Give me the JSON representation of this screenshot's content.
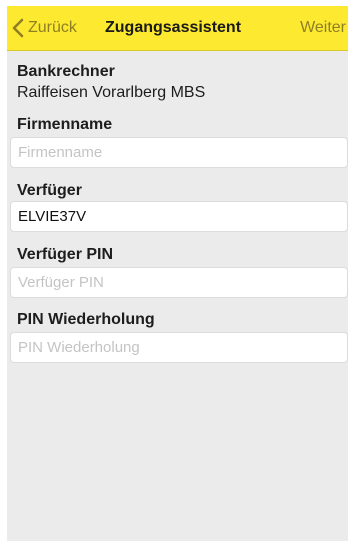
{
  "navbar": {
    "back_label": "Zurück",
    "title": "Zugangsassistent",
    "next_label": "Weiter",
    "color": "#fde92f",
    "back_icon": "chevron-left-icon"
  },
  "form": {
    "bankrechner": {
      "label": "Bankrechner",
      "value": "Raiffeisen Vorarlberg MBS"
    },
    "firmenname": {
      "label": "Firmenname",
      "placeholder": "Firmenname",
      "value": ""
    },
    "verfueger": {
      "label": "Verfüger",
      "placeholder": "",
      "value": "ELVIE37V"
    },
    "verfueger_pin": {
      "label": "Verfüger PIN",
      "placeholder": "Verfüger PIN",
      "value": ""
    },
    "pin_wiederholung": {
      "label": "PIN Wiederholung",
      "placeholder": "PIN Wiederholung",
      "value": ""
    }
  }
}
